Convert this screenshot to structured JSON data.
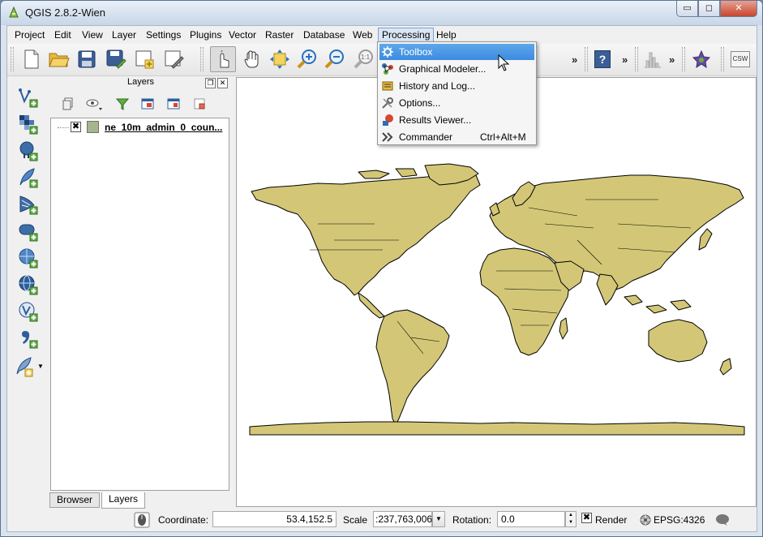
{
  "window": {
    "title": "QGIS 2.8.2-Wien",
    "min_glyph": "▭",
    "max_glyph": "◻",
    "close_glyph": "✕"
  },
  "menubar": {
    "items": [
      {
        "label": "Project",
        "key": "P"
      },
      {
        "label": "Edit",
        "key": "E"
      },
      {
        "label": "View",
        "key": "V"
      },
      {
        "label": "Layer",
        "key": "L"
      },
      {
        "label": "Settings",
        "key": "S"
      },
      {
        "label": "Plugins",
        "key": "P"
      },
      {
        "label": "Vector",
        "key": "o"
      },
      {
        "label": "Raster",
        "key": "R"
      },
      {
        "label": "Database",
        "key": "D"
      },
      {
        "label": "Web",
        "key": "W"
      },
      {
        "label": "Processing",
        "key": "c"
      },
      {
        "label": "Help",
        "key": "H"
      }
    ],
    "active": "Processing"
  },
  "processing_menu": {
    "items": [
      {
        "label": "Toolbox",
        "icon": "gear-icon",
        "shortcut": ""
      },
      {
        "label": "Graphical Modeler...",
        "icon": "modeler-icon",
        "shortcut": ""
      },
      {
        "label": "History and Log...",
        "icon": "history-icon",
        "shortcut": ""
      },
      {
        "label": "Options...",
        "icon": "tools-icon",
        "shortcut": ""
      },
      {
        "label": "Results Viewer...",
        "icon": "results-icon",
        "shortcut": ""
      },
      {
        "label": "Commander",
        "icon": "commander-icon",
        "shortcut": "Ctrl+Alt+M"
      }
    ],
    "highlighted": "Toolbox"
  },
  "toolbar": {
    "chevron": "»",
    "csw_label": "CSW",
    "help_glyph": "?",
    "zoom_label": "1:1"
  },
  "layers_panel": {
    "title": "Layers",
    "float_glyph": "❐",
    "close_glyph": "✕",
    "layers": [
      {
        "name": "ne_10m_admin_0_coun...",
        "visible_mark": "✖",
        "color": "#a6b590"
      }
    ],
    "tabs": [
      "Browser",
      "Layers"
    ],
    "active_tab": "Layers"
  },
  "map": {
    "fill_color": "#d3c777",
    "stroke_color": "#000000"
  },
  "statusbar": {
    "coordinate_label": "Coordinate:",
    "coordinate_value": "53.4,152.5",
    "scale_label": "Scale",
    "scale_value": ":237,763,006",
    "rotation_label": "Rotation:",
    "rotation_value": "0.0",
    "render_label": "Render",
    "render_mark": "✖",
    "crs_label": "EPSG:4326",
    "drop_glyph": "▼",
    "spin_up": "▲",
    "spin_down": "▼"
  }
}
